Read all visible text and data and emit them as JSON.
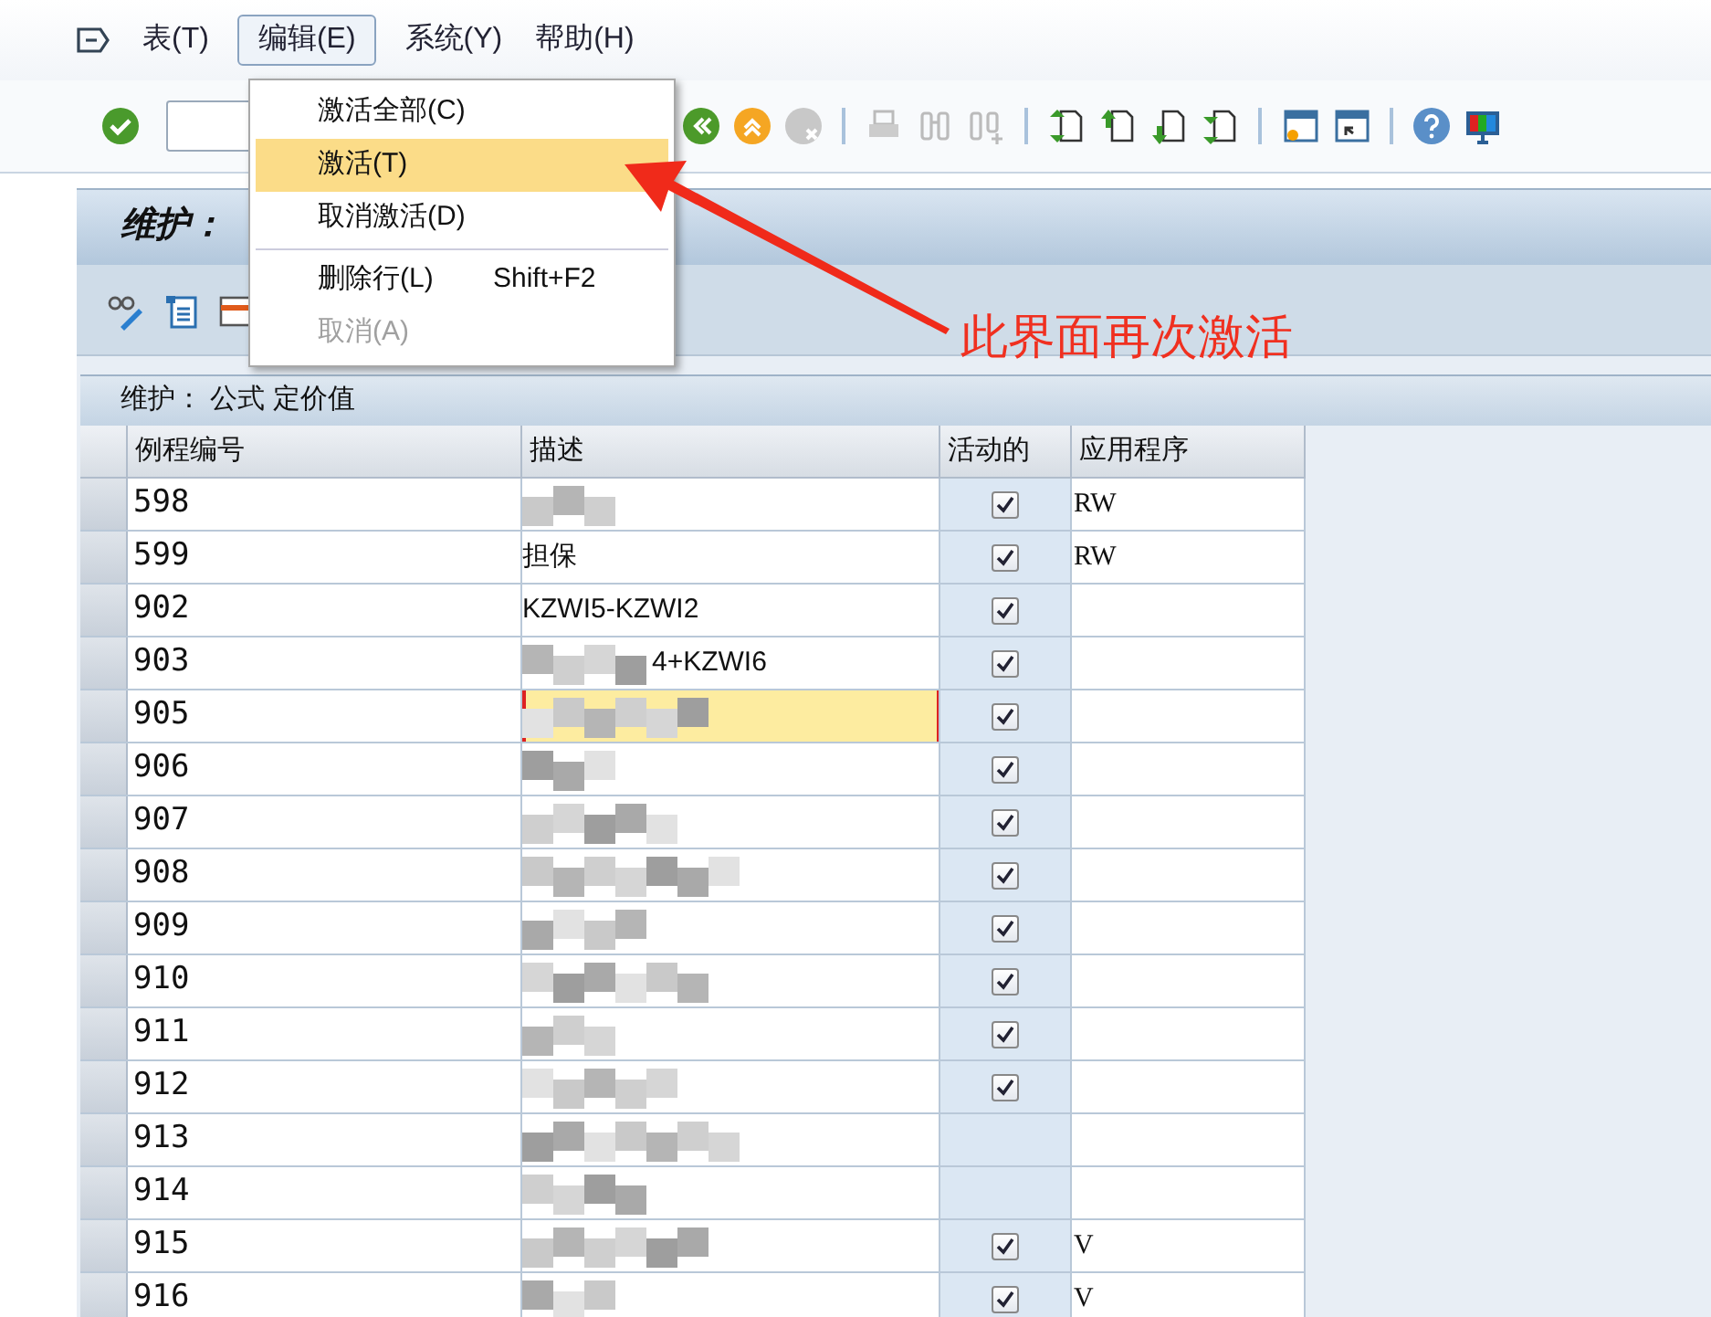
{
  "menu_bar": [
    {
      "label": "表(T)",
      "selected": false
    },
    {
      "label": "编辑(E)",
      "selected": true
    },
    {
      "label": "系统(Y)",
      "selected": false
    },
    {
      "label": "帮助(H)",
      "selected": false
    }
  ],
  "dropdown": [
    {
      "label": "激活全部(C)",
      "selected": false,
      "disabled": false
    },
    {
      "label": "激活(T)",
      "selected": true,
      "disabled": false
    },
    {
      "label": "取消激活(D)",
      "selected": false,
      "disabled": false
    },
    {
      "label": "删除行(L)",
      "shortcut": "Shift+F2",
      "selected": false,
      "disabled": false
    },
    {
      "label": "取消(A)",
      "selected": false,
      "disabled": true
    }
  ],
  "screen_title": "维护：",
  "table": {
    "title": "维护： 公式 定价值",
    "columns": [
      "例程编号",
      "描述",
      "活动的",
      "应用程序"
    ],
    "rows": [
      {
        "number": "598",
        "blurred": true,
        "active": true,
        "application": "RW",
        "selected": false
      },
      {
        "number": "599",
        "description": "担保",
        "blurred": false,
        "active": true,
        "application": "RW",
        "selected": false
      },
      {
        "number": "902",
        "description": "KZWI5-KZWI2",
        "blurred": false,
        "active": true,
        "selected": false
      },
      {
        "number": "903",
        "description": "4+KZWI6",
        "blurred": true,
        "active": true,
        "selected": false
      },
      {
        "number": "905",
        "blurred": true,
        "active": true,
        "selected": true
      },
      {
        "number": "906",
        "blurred": true,
        "active": true,
        "selected": false
      },
      {
        "number": "907",
        "blurred": true,
        "active": true,
        "selected": false
      },
      {
        "number": "908",
        "blurred": true,
        "active": true,
        "selected": false
      },
      {
        "number": "909",
        "blurred": true,
        "active": true,
        "selected": false
      },
      {
        "number": "910",
        "blurred": true,
        "active": true,
        "selected": false
      },
      {
        "number": "911",
        "blurred": true,
        "active": true,
        "selected": false
      },
      {
        "number": "912",
        "blurred": true,
        "active": true,
        "selected": false
      },
      {
        "number": "913",
        "blurred": true,
        "selected": false
      },
      {
        "number": "914",
        "blurred": true,
        "selected": false
      },
      {
        "number": "915",
        "blurred": true,
        "active": true,
        "application": "V",
        "selected": false
      },
      {
        "number": "916",
        "blurred": true,
        "active": true,
        "application": "V",
        "selected": false
      }
    ]
  },
  "annotation": {
    "text": "此界面再次激活"
  }
}
